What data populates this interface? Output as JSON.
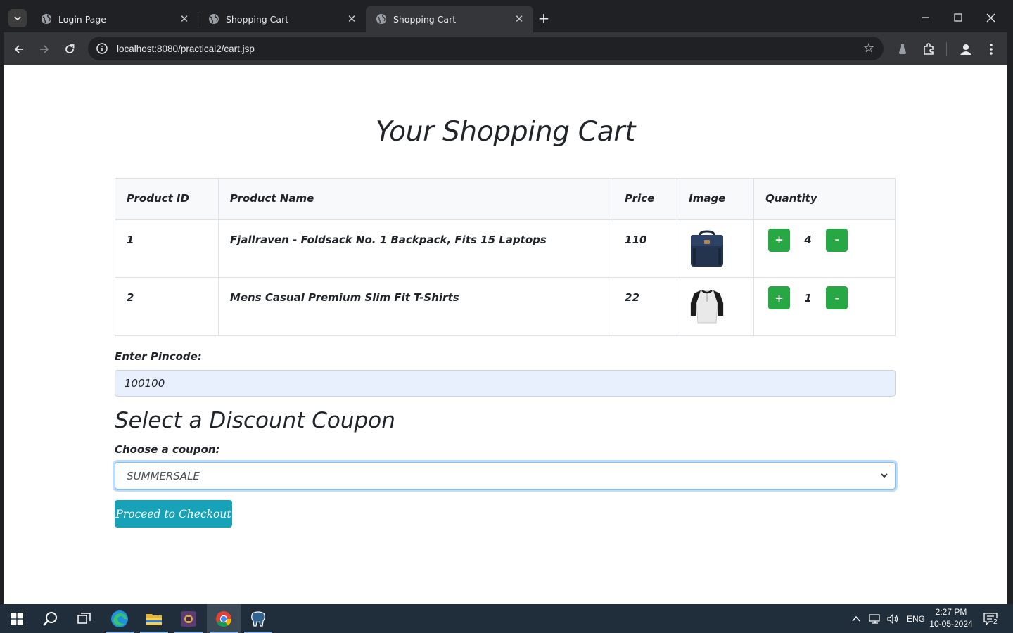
{
  "browser": {
    "tabs": [
      {
        "title": "Login Page",
        "active": false
      },
      {
        "title": "Shopping Cart",
        "active": false
      },
      {
        "title": "Shopping Cart",
        "active": true
      }
    ],
    "url": "localhost:8080/practical2/cart.jsp"
  },
  "page": {
    "title": "Your Shopping Cart",
    "table": {
      "headers": [
        "Product ID",
        "Product Name",
        "Price",
        "Image",
        "Quantity"
      ],
      "rows": [
        {
          "id": "1",
          "name": "Fjallraven - Foldsack No. 1 Backpack, Fits 15 Laptops",
          "price": "110",
          "image": "backpack-image",
          "quantity": "4",
          "plus": "+",
          "minus": "-"
        },
        {
          "id": "2",
          "name": "Mens Casual Premium Slim Fit T-Shirts",
          "price": "22",
          "image": "tshirt-image",
          "quantity": "1",
          "plus": "+",
          "minus": "-"
        }
      ]
    },
    "pincode": {
      "label": "Enter Pincode:",
      "value": "100100"
    },
    "coupon": {
      "heading": "Select a Discount Coupon",
      "label": "Choose a coupon:",
      "selected": "SUMMERSALE"
    },
    "checkout_label": "Proceed to Checkout"
  },
  "taskbar": {
    "language": "ENG",
    "time": "2:27 PM",
    "date": "10-05-2024",
    "notification_count": "2"
  },
  "colors": {
    "qty_button": "#28a745",
    "checkout_button": "#17a2b8",
    "autofill_bg": "#e8f0fe",
    "focus_border": "#80bdff"
  }
}
